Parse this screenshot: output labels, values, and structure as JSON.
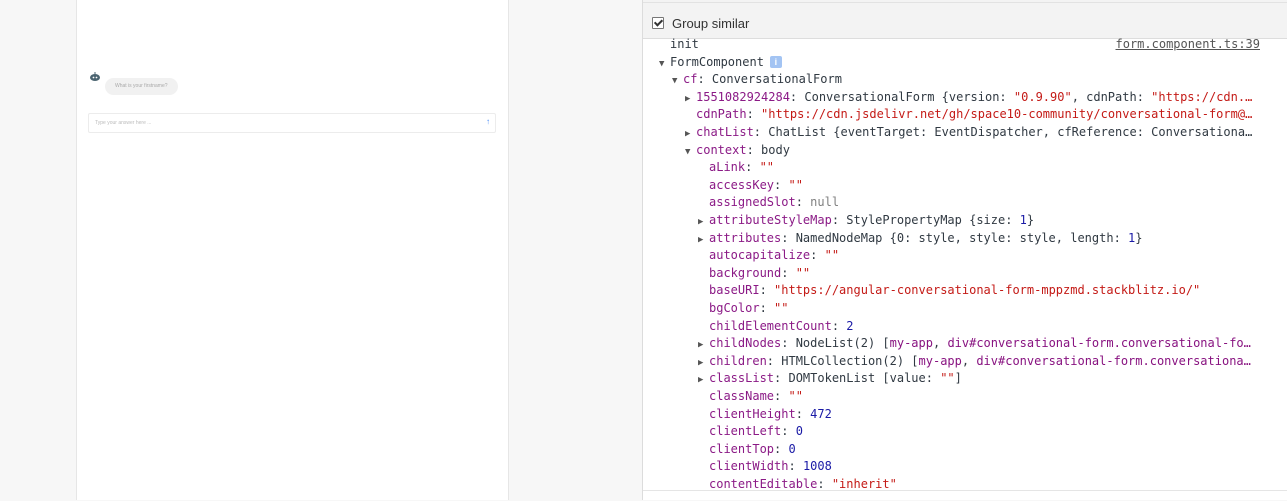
{
  "preview": {
    "bot_question": "What is your firstname?",
    "input_placeholder": "Type your answer here ...",
    "send_icon": "arrow-up-icon",
    "accent": "#4a8cf7"
  },
  "devtools": {
    "group_similar_label": "Group similar",
    "group_similar_checked": true,
    "source_link": "form.component.ts:39",
    "info_badge": "i",
    "lines": [
      {
        "indent": 0,
        "toggle": "none",
        "parts": [
          {
            "t": "init",
            "c": "pl"
          }
        ]
      },
      {
        "indent": 0,
        "toggle": "down",
        "parts": [
          {
            "t": "FormComponent",
            "c": "pl"
          }
        ],
        "badge": true
      },
      {
        "indent": 1,
        "toggle": "down",
        "parts": [
          {
            "t": "cf",
            "c": "k"
          },
          {
            "t": ": ConversationalForm",
            "c": "pl"
          }
        ]
      },
      {
        "indent": 2,
        "toggle": "right",
        "parts": [
          {
            "t": "1551082924284",
            "c": "k"
          },
          {
            "t": ": ConversationalForm {version: ",
            "c": "pl"
          },
          {
            "t": "\"0.9.90\"",
            "c": "s"
          },
          {
            "t": ", cdnPath: ",
            "c": "pl"
          },
          {
            "t": "\"https://cdn.…",
            "c": "s"
          }
        ]
      },
      {
        "indent": 2,
        "toggle": "none",
        "parts": [
          {
            "t": "cdnPath",
            "c": "k"
          },
          {
            "t": ": ",
            "c": "pl"
          },
          {
            "t": "\"https://cdn.jsdelivr.net/gh/space10-community/conversational-form@…",
            "c": "s"
          }
        ]
      },
      {
        "indent": 2,
        "toggle": "right",
        "parts": [
          {
            "t": "chatList",
            "c": "k"
          },
          {
            "t": ": ChatList {eventTarget: EventDispatcher, cfReference: Conversationa…",
            "c": "pl"
          }
        ]
      },
      {
        "indent": 2,
        "toggle": "down",
        "parts": [
          {
            "t": "context",
            "c": "k"
          },
          {
            "t": ": body",
            "c": "pl"
          }
        ]
      },
      {
        "indent": 3,
        "toggle": "none",
        "parts": [
          {
            "t": "aLink",
            "c": "k"
          },
          {
            "t": ": ",
            "c": "pl"
          },
          {
            "t": "\"\"",
            "c": "s"
          }
        ]
      },
      {
        "indent": 3,
        "toggle": "none",
        "parts": [
          {
            "t": "accessKey",
            "c": "k"
          },
          {
            "t": ": ",
            "c": "pl"
          },
          {
            "t": "\"\"",
            "c": "s"
          }
        ]
      },
      {
        "indent": 3,
        "toggle": "none",
        "parts": [
          {
            "t": "assignedSlot",
            "c": "k"
          },
          {
            "t": ": ",
            "c": "pl"
          },
          {
            "t": "null",
            "c": "nl"
          }
        ]
      },
      {
        "indent": 3,
        "toggle": "right",
        "parts": [
          {
            "t": "attributeStyleMap",
            "c": "k"
          },
          {
            "t": ": StylePropertyMap {size: ",
            "c": "pl"
          },
          {
            "t": "1",
            "c": "n"
          },
          {
            "t": "}",
            "c": "pl"
          }
        ]
      },
      {
        "indent": 3,
        "toggle": "right",
        "parts": [
          {
            "t": "attributes",
            "c": "k"
          },
          {
            "t": ": NamedNodeMap {0: style, style: style, length: ",
            "c": "pl"
          },
          {
            "t": "1",
            "c": "n"
          },
          {
            "t": "}",
            "c": "pl"
          }
        ]
      },
      {
        "indent": 3,
        "toggle": "none",
        "parts": [
          {
            "t": "autocapitalize",
            "c": "k"
          },
          {
            "t": ": ",
            "c": "pl"
          },
          {
            "t": "\"\"",
            "c": "s"
          }
        ]
      },
      {
        "indent": 3,
        "toggle": "none",
        "parts": [
          {
            "t": "background",
            "c": "k"
          },
          {
            "t": ": ",
            "c": "pl"
          },
          {
            "t": "\"\"",
            "c": "s"
          }
        ]
      },
      {
        "indent": 3,
        "toggle": "none",
        "parts": [
          {
            "t": "baseURI",
            "c": "k"
          },
          {
            "t": ": ",
            "c": "pl"
          },
          {
            "t": "\"https://angular-conversational-form-mppzmd.stackblitz.io/\"",
            "c": "s"
          }
        ]
      },
      {
        "indent": 3,
        "toggle": "none",
        "parts": [
          {
            "t": "bgColor",
            "c": "k"
          },
          {
            "t": ": ",
            "c": "pl"
          },
          {
            "t": "\"\"",
            "c": "s"
          }
        ]
      },
      {
        "indent": 3,
        "toggle": "none",
        "parts": [
          {
            "t": "childElementCount",
            "c": "k"
          },
          {
            "t": ": ",
            "c": "pl"
          },
          {
            "t": "2",
            "c": "n"
          }
        ]
      },
      {
        "indent": 3,
        "toggle": "right",
        "parts": [
          {
            "t": "childNodes",
            "c": "k"
          },
          {
            "t": ": NodeList(2) [",
            "c": "pl"
          },
          {
            "t": "my-app",
            "c": "tag"
          },
          {
            "t": ", ",
            "c": "pl"
          },
          {
            "t": "div#conversational-form.conversational-fo…",
            "c": "tag"
          }
        ]
      },
      {
        "indent": 3,
        "toggle": "right",
        "parts": [
          {
            "t": "children",
            "c": "k"
          },
          {
            "t": ": HTMLCollection(2) [",
            "c": "pl"
          },
          {
            "t": "my-app",
            "c": "tag"
          },
          {
            "t": ", ",
            "c": "pl"
          },
          {
            "t": "div#conversational-form.conversationa…",
            "c": "tag"
          }
        ]
      },
      {
        "indent": 3,
        "toggle": "right",
        "parts": [
          {
            "t": "classList",
            "c": "k"
          },
          {
            "t": ": DOMTokenList [value: ",
            "c": "pl"
          },
          {
            "t": "\"\"",
            "c": "s"
          },
          {
            "t": "]",
            "c": "pl"
          }
        ]
      },
      {
        "indent": 3,
        "toggle": "none",
        "parts": [
          {
            "t": "className",
            "c": "k"
          },
          {
            "t": ": ",
            "c": "pl"
          },
          {
            "t": "\"\"",
            "c": "s"
          }
        ]
      },
      {
        "indent": 3,
        "toggle": "none",
        "parts": [
          {
            "t": "clientHeight",
            "c": "k"
          },
          {
            "t": ": ",
            "c": "pl"
          },
          {
            "t": "472",
            "c": "n"
          }
        ]
      },
      {
        "indent": 3,
        "toggle": "none",
        "parts": [
          {
            "t": "clientLeft",
            "c": "k"
          },
          {
            "t": ": ",
            "c": "pl"
          },
          {
            "t": "0",
            "c": "n"
          }
        ]
      },
      {
        "indent": 3,
        "toggle": "none",
        "parts": [
          {
            "t": "clientTop",
            "c": "k"
          },
          {
            "t": ": ",
            "c": "pl"
          },
          {
            "t": "0",
            "c": "n"
          }
        ]
      },
      {
        "indent": 3,
        "toggle": "none",
        "parts": [
          {
            "t": "clientWidth",
            "c": "k"
          },
          {
            "t": ": ",
            "c": "pl"
          },
          {
            "t": "1008",
            "c": "n"
          }
        ]
      },
      {
        "indent": 3,
        "toggle": "none",
        "parts": [
          {
            "t": "contentEditable",
            "c": "k"
          },
          {
            "t": ": ",
            "c": "pl"
          },
          {
            "t": "\"inherit\"",
            "c": "s"
          }
        ]
      }
    ]
  }
}
